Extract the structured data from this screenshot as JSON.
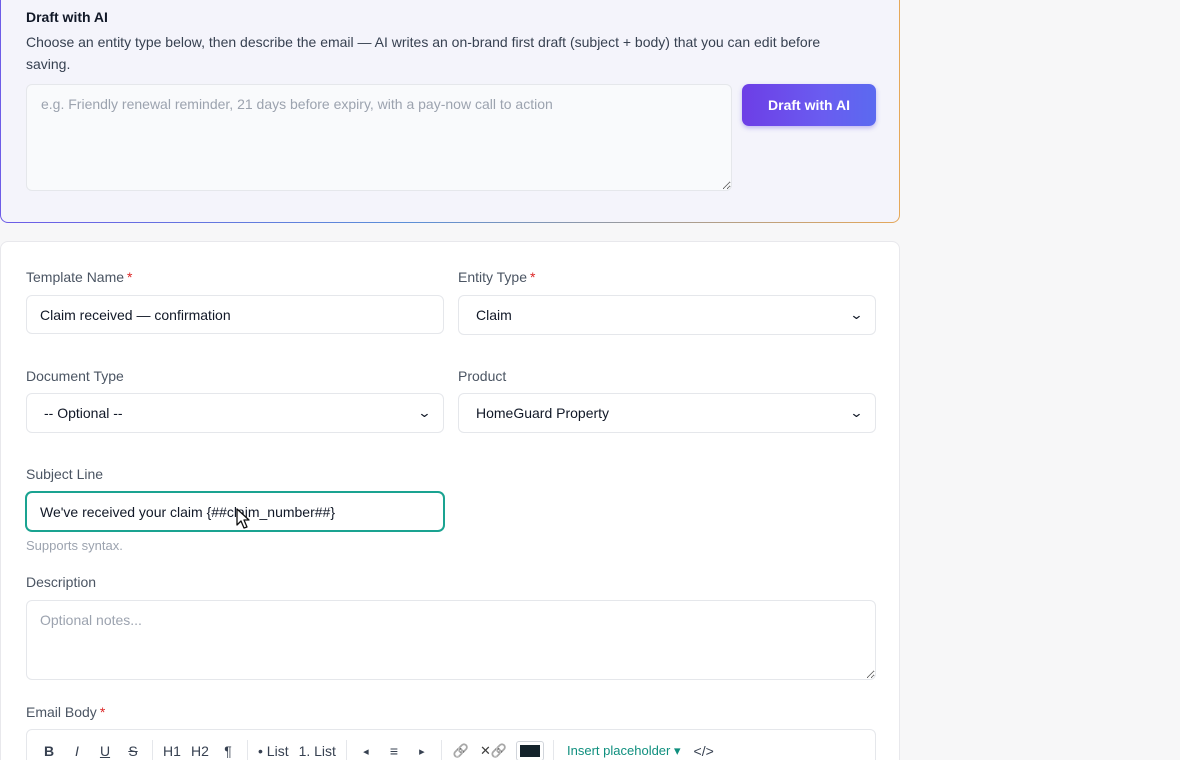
{
  "ai_draft": {
    "title": "Draft with AI",
    "description": "Choose an entity type below, then describe the email — AI writes an on-brand first draft (subject + body) that you can edit before saving.",
    "prompt_placeholder": "e.g. Friendly renewal reminder, 21 days before expiry, with a pay-now call to action",
    "button_label": "Draft with AI"
  },
  "form": {
    "template_name": {
      "label": "Template Name",
      "required": "*",
      "value": "Claim received — confirmation"
    },
    "entity_type": {
      "label": "Entity Type",
      "required": "*",
      "value": "Claim"
    },
    "document_type": {
      "label": "Document Type",
      "value": "-- Optional --"
    },
    "product": {
      "label": "Product",
      "value": "HomeGuard Property"
    },
    "subject_line": {
      "label": "Subject Line",
      "value": "We've received your claim {##claim_number##}",
      "help": "Supports syntax."
    },
    "description": {
      "label": "Description",
      "placeholder": "Optional notes..."
    },
    "email_body": {
      "label": "Email Body",
      "required": "*"
    }
  },
  "toolbar": {
    "bold": "B",
    "italic": "I",
    "underline": "U",
    "strike": "S",
    "h1": "H1",
    "h2": "H2",
    "paragraph": "¶",
    "bullet_list": "• List",
    "numbered_list": "1. List",
    "align_left": "◂",
    "align_center": "≡",
    "align_right": "▸",
    "link": "🔗",
    "unlink": "✕🔗",
    "text_color": "#14232b",
    "insert_placeholder": "Insert placeholder ▾",
    "source": "</>"
  },
  "colors": {
    "accent": "#6d3ee6",
    "focus": "#1aa391",
    "required": "#dc2626",
    "link_accent": "#0f8f7e"
  }
}
